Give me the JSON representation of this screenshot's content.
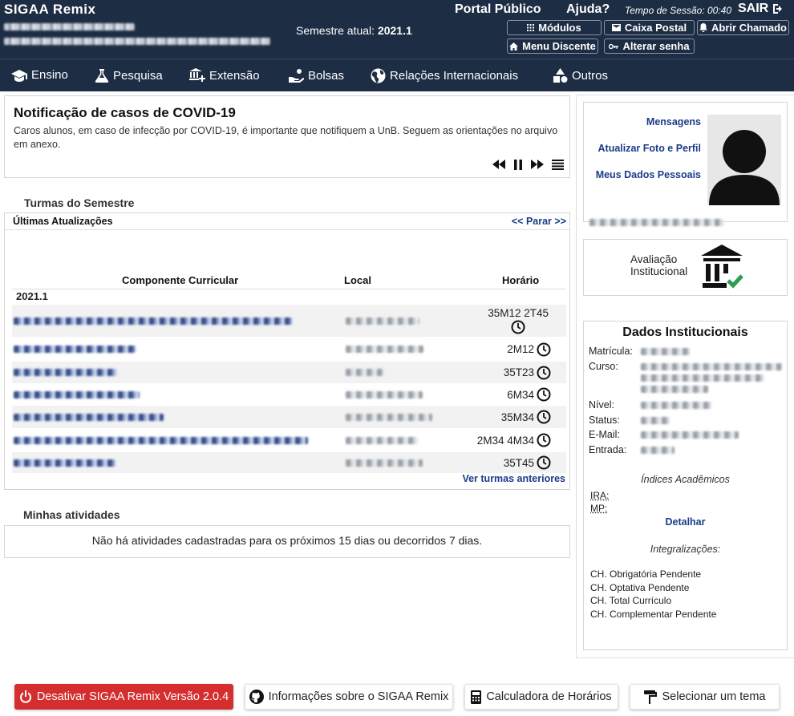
{
  "app": {
    "brand": "SIGAA Remix"
  },
  "header": {
    "semester_label": "Semestre atual:",
    "semester_value": "2021.1",
    "portal_publico": "Portal Público",
    "ajuda": "Ajuda?",
    "session_label": "Tempo de Sessão:",
    "session_time": "00:40",
    "sair": "SAIR",
    "buttons": {
      "modulos": "Módulos",
      "caixa_postal": "Caixa Postal",
      "abrir_chamado": "Abrir Chamado",
      "menu_discente": "Menu Discente",
      "alterar_senha": "Alterar senha"
    }
  },
  "nav": {
    "items": [
      "Ensino",
      "Pesquisa",
      "Extensão",
      "Bolsas",
      "Relações Internacionais",
      "Outros"
    ]
  },
  "notice": {
    "title": "Notificação de casos de COVID-19",
    "text": "Caros alunos, em caso de infecção por COVID-19, é importante que notifiquem a UnB. Seguem as orientações no arquivo em anexo."
  },
  "turmas": {
    "section_title": "Turmas do Semestre",
    "updates_label": "Últimas Atualizações",
    "stop_label": "<< Parar >>",
    "col_componente": "Componente Curricular",
    "col_local": "Local",
    "col_horario": "Horário",
    "year": "2021.1",
    "rows": [
      {
        "horario": "35M12 2T45"
      },
      {
        "horario": "2M12"
      },
      {
        "horario": "35T23"
      },
      {
        "horario": "6M34"
      },
      {
        "horario": "35M34"
      },
      {
        "horario": "2M34 4M34"
      },
      {
        "horario": "35T45"
      }
    ],
    "previous_link": "Ver turmas anteriores"
  },
  "atividades": {
    "section_title": "Minhas atividades",
    "empty_text": "Não há atividades cadastradas para os próximos 15 dias ou decorridos 7 dias."
  },
  "profile": {
    "mensagens": "Mensagens",
    "atualizar_foto": "Atualizar Foto e Perfil",
    "meus_dados": "Meus Dados Pessoais"
  },
  "avaliacao": {
    "line1": "Avaliação",
    "line2": "Institucional"
  },
  "dados": {
    "title": "Dados Institucionais",
    "labels": {
      "matricula": "Matrícula:",
      "curso": "Curso:",
      "nivel": "Nível:",
      "status": "Status:",
      "email": "E-Mail:",
      "entrada": "Entrada:"
    },
    "indices_title": "Índices Acadêmicos",
    "ira": "IRA:",
    "mp": "MP:",
    "detalhar": "Detalhar",
    "integralizacoes_title": "Integralizações:",
    "integralizacoes": [
      "CH. Obrigatória Pendente",
      "CH. Optativa Pendente",
      "CH. Total Currículo",
      "CH. Complementar Pendente"
    ]
  },
  "footer": {
    "desativar": "Desativar SIGAA Remix Versão 2.0.4",
    "informacoes": "Informações sobre o SIGAA Remix",
    "calculadora": "Calculadora de Horários",
    "tema": "Selecionar um tema"
  },
  "colors": {
    "header_bg": "#1d2d44",
    "link": "#1a3b8a",
    "danger": "#d42e2e"
  }
}
